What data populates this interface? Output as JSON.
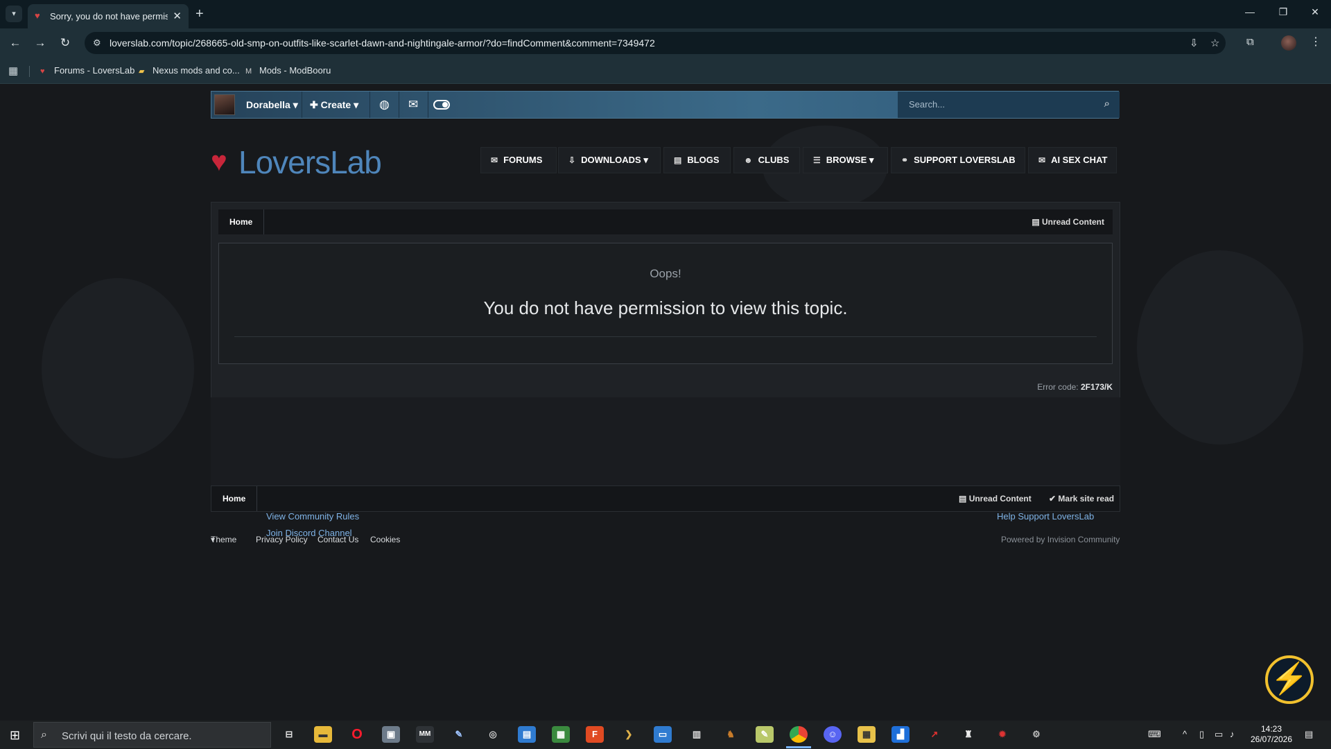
{
  "browser": {
    "tab_title": "Sorry, you do not have permission",
    "url": "loverslab.com/topic/268665-old-smp-on-outfits-like-scarlet-dawn-and-nightingale-armor/?do=findComment&comment=7349472",
    "bookmarks": [
      {
        "label": "Forums - LoversLab",
        "icon": "loverslab-heart-icon"
      },
      {
        "label": "Nexus mods and co...",
        "icon": "folder-icon"
      },
      {
        "label": "Mods - ModBooru",
        "icon": "modbooru-icon"
      }
    ]
  },
  "userbar": {
    "username": "Dorabella",
    "create_label": "Create",
    "search_placeholder": "Search..."
  },
  "logo_text": "LoversLab",
  "main_nav": [
    {
      "label": "FORUMS",
      "icon": "comments-icon"
    },
    {
      "label": "DOWNLOADS",
      "icon": "download-icon",
      "dropdown": true
    },
    {
      "label": "BLOGS",
      "icon": "book-icon"
    },
    {
      "label": "CLUBS",
      "icon": "users-icon"
    },
    {
      "label": "BROWSE",
      "icon": "list-icon",
      "dropdown": true
    },
    {
      "label": "SUPPORT LOVERSLAB",
      "icon": "handshake-icon"
    },
    {
      "label": "AI SEX CHAT",
      "icon": "chat-icon"
    }
  ],
  "breadcrumb": {
    "home": "Home",
    "unread": "Unread Content",
    "mark_read": "Mark site read"
  },
  "error": {
    "title": "Oops!",
    "message": "You do not have permission to view this topic.",
    "code_label": "Error code:",
    "code_value": "2F173/K"
  },
  "footer_links": {
    "rules": "View Community Rules",
    "discord": "Join Discord Channel",
    "support": "Help Support LoversLab"
  },
  "site_footer": {
    "theme": "Theme",
    "privacy": "Privacy Policy",
    "contact": "Contact Us",
    "cookies": "Cookies",
    "powered": "Powered by Invision Community"
  },
  "taskbar": {
    "search_placeholder": "Scrivi qui il testo da cercare.",
    "time": "14:23",
    "date": "26/07/2026"
  },
  "colors": {
    "accent": "#4f86bb",
    "link": "#7fb3e6",
    "heart": "#c8263a",
    "fab": "#f2c12e"
  }
}
